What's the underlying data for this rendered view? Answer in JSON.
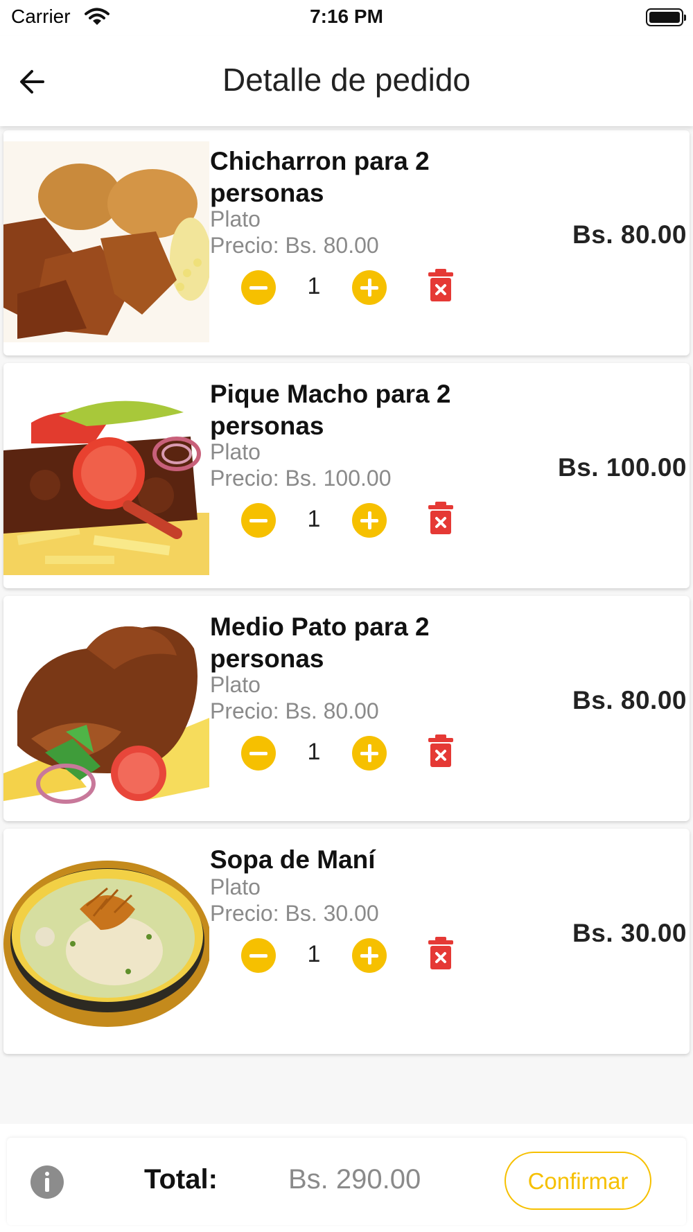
{
  "status_bar": {
    "carrier": "Carrier",
    "time": "7:16 PM"
  },
  "header": {
    "title": "Detalle de pedido",
    "back_icon": "arrow-left-icon"
  },
  "order_items": [
    {
      "name": "Chicharron para 2 personas",
      "type": "Plato",
      "price": "Precio: Bs. 80.00",
      "quantity": "1",
      "subtotal": "Bs. 80.00",
      "image": "chicharron-image"
    },
    {
      "name": "Pique Macho para 2 personas",
      "type": "Plato",
      "price": "Precio: Bs. 100.00",
      "quantity": "1",
      "subtotal": "Bs. 100.00",
      "image": "pique-macho-image"
    },
    {
      "name": "Medio Pato para 2 personas",
      "type": "Plato",
      "price": "Precio: Bs. 80.00",
      "quantity": "1",
      "subtotal": "Bs. 80.00",
      "image": "medio-pato-image"
    },
    {
      "name": "Sopa de Maní",
      "type": "Plato",
      "price": "Precio: Bs. 30.00",
      "quantity": "1",
      "subtotal": "Bs. 30.00",
      "image": "sopa-de-mani-image"
    }
  ],
  "footer": {
    "total_label": "Total:",
    "total_value": "Bs. 290.00",
    "confirm_label": "Confirmar",
    "info_icon": "info-icon"
  },
  "colors": {
    "accent": "#f6c000",
    "delete": "#e53935",
    "muted_text": "#8a8a8a"
  }
}
